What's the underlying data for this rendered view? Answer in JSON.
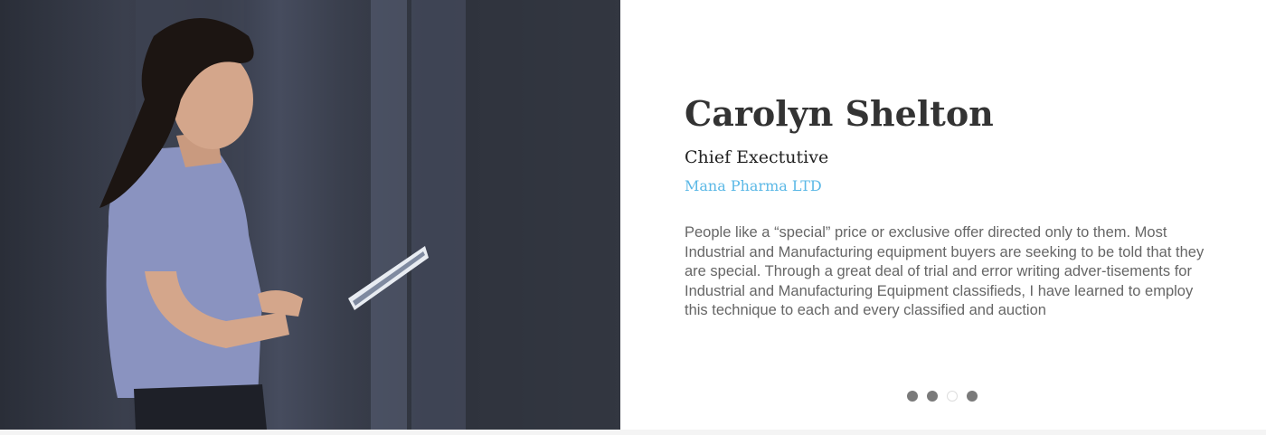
{
  "testimonial": {
    "name": "Carolyn Shelton",
    "role": "Chief Exectutive",
    "company": "Mana Pharma LTD",
    "quote": "People like a “special” price or exclusive offer directed only to them. Most Industrial and Manufacturing equipment buyers are seeking to be told that they are special. Through a great deal of trial and error writing adver-tisements for Industrial and Manufacturing Equipment classifieds, I have learned to employ this technique to each and every classified and auction"
  },
  "carousel": {
    "total_slides": 4,
    "active_index": 2
  },
  "colors": {
    "accent": "#5bb8e6",
    "dot": "#7a7a7a"
  }
}
